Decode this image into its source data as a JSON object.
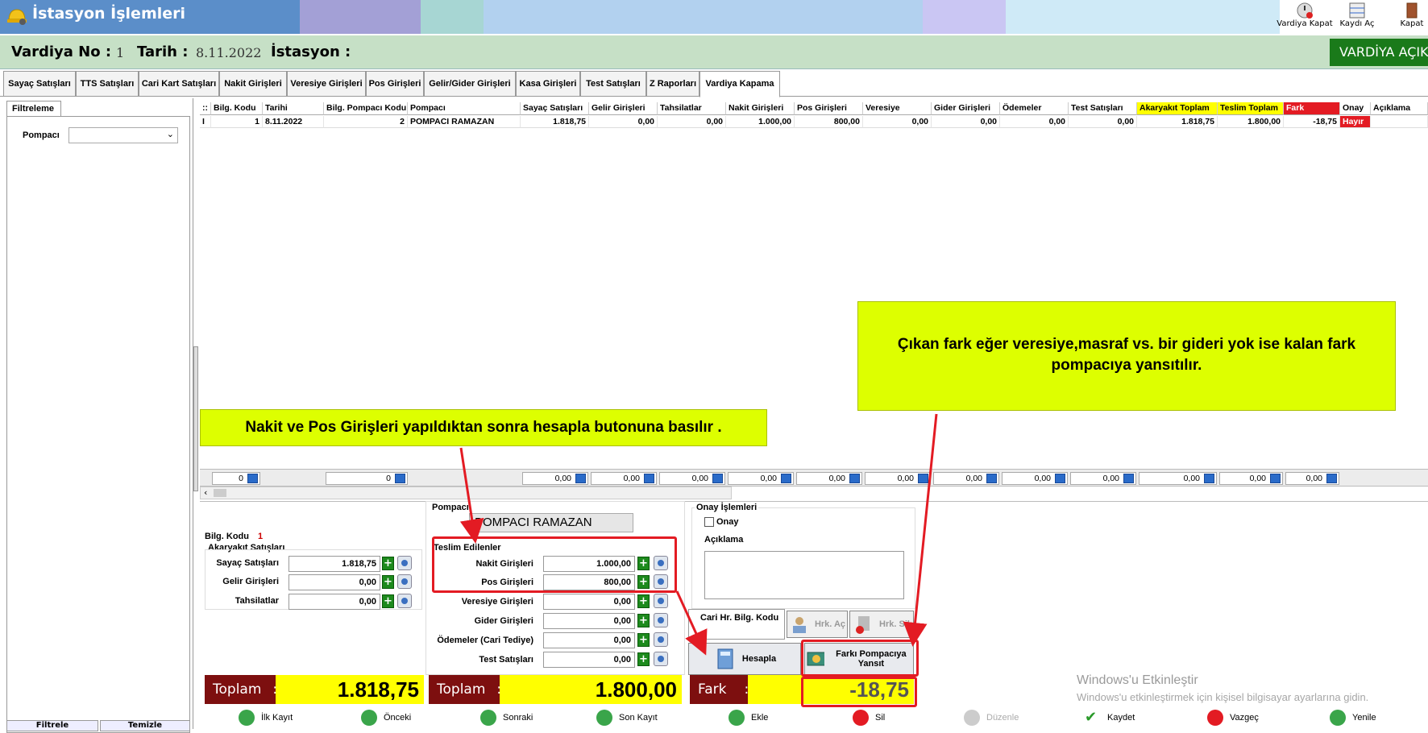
{
  "window": {
    "title": "İstasyon İşlemleri"
  },
  "toolbar": {
    "close_shift": "Vardiya Kapat",
    "open_record": "Kaydı Aç",
    "close": "Kapat"
  },
  "shift": {
    "no_label": "Vardiya No :",
    "no_value": "1",
    "date_label": "Tarih :",
    "date_value": "8.11.2022",
    "station_label": "İstasyon :",
    "status_button": "VARDİYA AÇIK"
  },
  "tabs": [
    "Sayaç Satışları",
    "TTS Satışları",
    "Cari Kart Satışları",
    "Nakit Girişleri",
    "Veresiye Girişleri",
    "Pos Girişleri",
    "Gelir/Gider Girişleri",
    "Kasa Girişleri",
    "Test Satışları",
    "Z Raporları",
    "Vardiya Kapama"
  ],
  "filter": {
    "tab": "Filtreleme",
    "pompaci_label": "Pompacı",
    "filter_button": "Filtrele",
    "clear_button": "Temizle"
  },
  "grid": {
    "headers": [
      "Bilg. Kodu",
      "Tarihi",
      "Bilg. Pompacı Kodu",
      "Pompacı",
      "Sayaç Satışları",
      "Gelir Girişleri",
      "Tahsilatlar",
      "Nakit Girişleri",
      "Pos Girişleri",
      "Veresiye",
      "Gider Girişleri",
      "Ödemeler",
      "Test Satışları",
      "Akaryakıt Toplam",
      "Teslim Toplam",
      "Fark",
      "Onay",
      "Açıklama"
    ],
    "row": [
      "1",
      "8.11.2022",
      "2",
      "POMPACI RAMAZAN",
      "1.818,75",
      "0,00",
      "0,00",
      "1.000,00",
      "800,00",
      "0,00",
      "0,00",
      "0,00",
      "0,00",
      "1.818,75",
      "1.800,00",
      "-18,75",
      "Hayır",
      ""
    ],
    "totals": [
      "0",
      "0",
      "0,00",
      "0,00",
      "0,00",
      "0,00",
      "0,00",
      "0,00",
      "0,00",
      "0,00",
      "0,00",
      "0,00",
      "0,00",
      "0,00"
    ]
  },
  "detail": {
    "bilg_kodu_label": "Bilg. Kodu",
    "bilg_kodu_value": "1",
    "fuel_group": "Akaryakıt Satışları",
    "sayac_label": "Sayaç Satışları",
    "sayac_value": "1.818,75",
    "gelir_label": "Gelir Girişleri",
    "gelir_value": "0,00",
    "tahsilat_label": "Tahsilatlar",
    "tahsilat_value": "0,00",
    "pompaci_group": "Pompacı",
    "pompaci_value": "POMPACI RAMAZAN",
    "teslim_group": "Teslim Edilenler",
    "nakit_label": "Nakit Girişleri",
    "nakit_value": "1.000,00",
    "pos_label": "Pos Girişleri",
    "pos_value": "800,00",
    "veresiye_label": "Veresiye Girişleri",
    "veresiye_value": "0,00",
    "gider_label": "Gider Girişleri",
    "gider_value": "0,00",
    "odeme_label": "Ödemeler (Cari Tediye)",
    "odeme_value": "0,00",
    "test_label": "Test Satışları",
    "test_value": "0,00",
    "onay_group": "Onay İşlemleri",
    "onay_label": "Onay",
    "aciklama_label": "Açıklama",
    "cari_tab": "Cari Hr. Bilg. Kodu",
    "hrk_ac": "Hrk. Aç",
    "hrk_sil": "Hrk. Sil",
    "hesapla": "Hesapla",
    "farki_yansit": "Farkı Pompacıya Yansıt",
    "toplam1_label": "Toplam",
    "toplam1_value": "1.818,75",
    "toplam2_label": "Toplam",
    "toplam2_value": "1.800,00",
    "fark_label": "Fark",
    "fark_value": "-18,75",
    "colon": ":"
  },
  "callouts": {
    "left": "Nakit ve Pos Girişleri yapıldıktan sonra hesapla butonuna basılır .",
    "right": "Çıkan fark eğer veresiye,masraf vs. bir gideri yok ise kalan fark pompacıya yansıtılır."
  },
  "bottom_nav": [
    "İlk Kayıt",
    "Önceki",
    "Sonraki",
    "Son Kayıt",
    "Ekle",
    "Sil",
    "Düzenle",
    "Kaydet",
    "Vazgeç",
    "Yenile"
  ],
  "watermark": {
    "line1": "Windows'u Etkinleştir",
    "line2": "Windows'u etkinleştirmek için kişisel bilgisayar ayarlarına gidin."
  },
  "colors": {
    "accent_red": "#e31b23",
    "callout": "#ddff00",
    "total_bg": "#7d0f0f",
    "yellow": "#ffff00"
  }
}
